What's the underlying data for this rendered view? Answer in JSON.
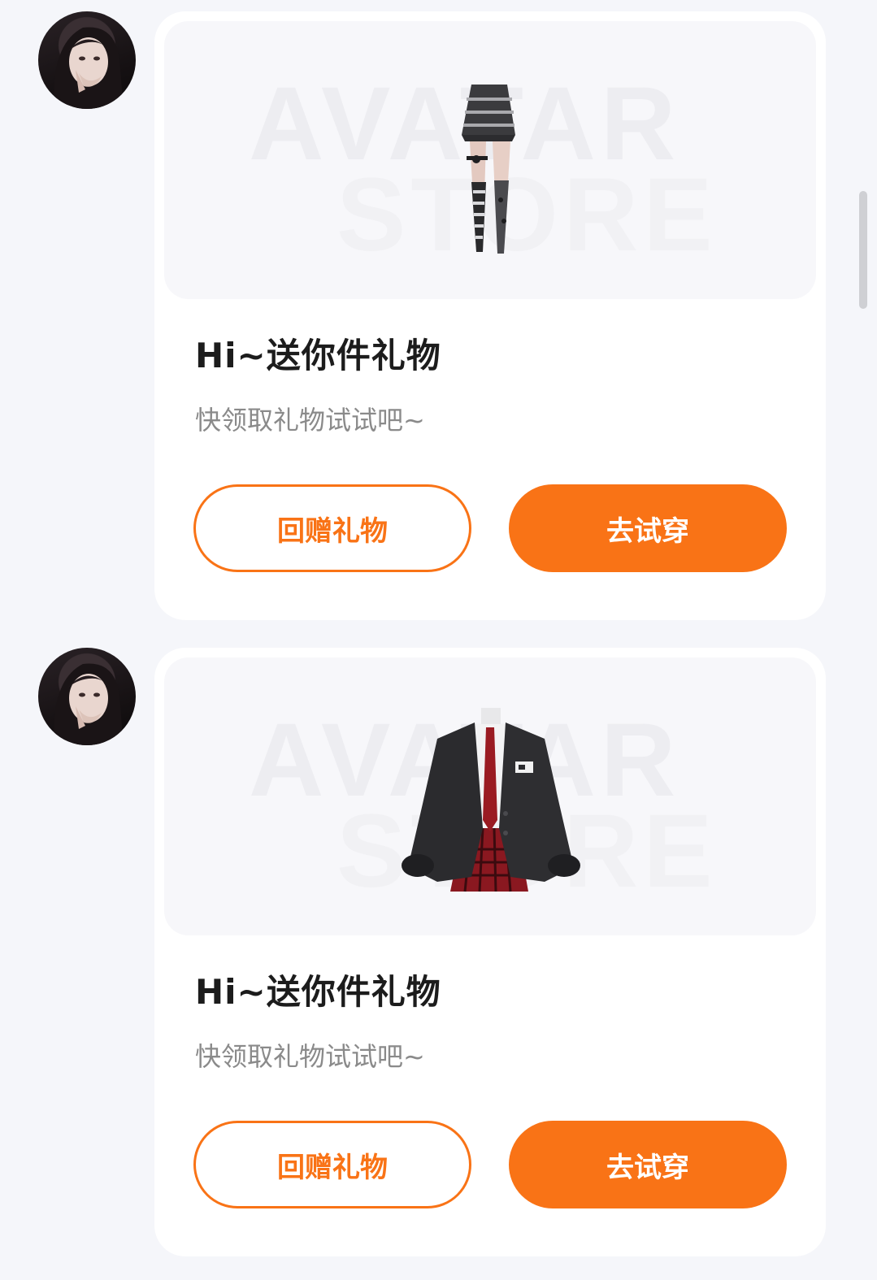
{
  "messages": [
    {
      "watermark_line1": "AVATAR",
      "watermark_line2": "STORE",
      "item_icon": "skirt-stockings-icon",
      "title": "Hi~送你件礼物",
      "subtitle": "快领取礼物试试吧~",
      "return_gift_label": "回赠礼物",
      "try_on_label": "去试穿"
    },
    {
      "watermark_line1": "AVATAR",
      "watermark_line2": "STORE",
      "item_icon": "school-uniform-blazer-icon",
      "title": "Hi~送你件礼物",
      "subtitle": "快领取礼物试试吧~",
      "return_gift_label": "回赠礼物",
      "try_on_label": "去试穿"
    }
  ],
  "colors": {
    "accent": "#f97316",
    "background": "#f5f6fa",
    "card": "#ffffff",
    "title_text": "#1c1c1c",
    "subtitle_text": "#8a8a8a"
  }
}
